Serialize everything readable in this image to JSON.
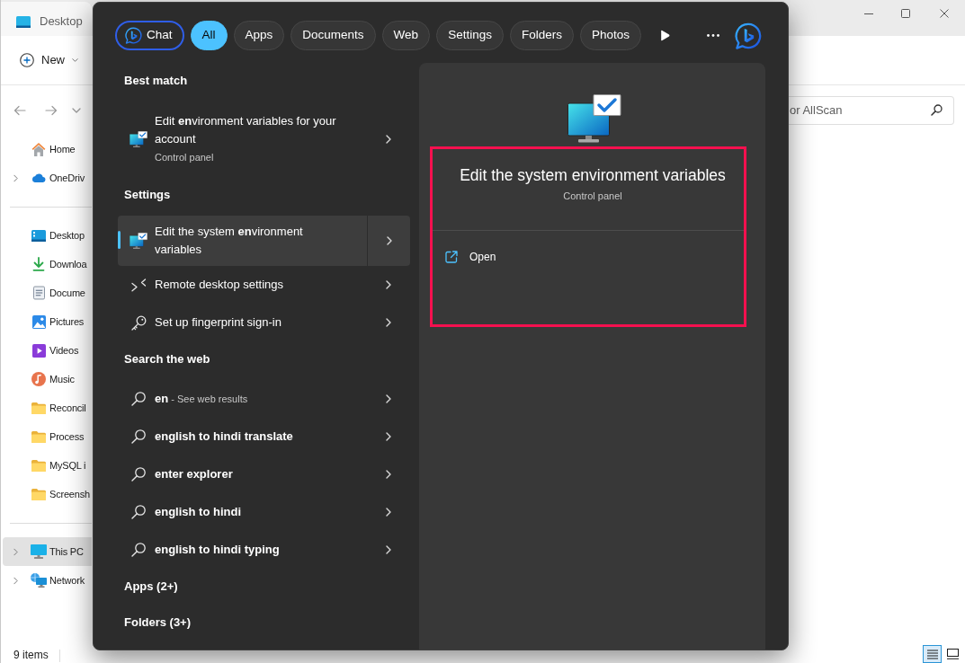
{
  "explorer": {
    "title": "Desktop",
    "new_button": "New",
    "search_placeholder": "or AllScan",
    "sidebar": {
      "groups": [
        {
          "items": [
            {
              "label": "Home",
              "kind": "home",
              "expandable": false,
              "selected": false
            },
            {
              "label": "OneDriv",
              "kind": "cloud",
              "expandable": true,
              "selected": false
            }
          ]
        },
        {
          "items": [
            {
              "label": "Desktop",
              "kind": "desktop",
              "expandable": false,
              "selected": false
            },
            {
              "label": "Downloa",
              "kind": "download",
              "expandable": false,
              "selected": false
            },
            {
              "label": "Docume",
              "kind": "document",
              "expandable": false,
              "selected": false
            },
            {
              "label": "Pictures",
              "kind": "pictures",
              "expandable": false,
              "selected": false
            },
            {
              "label": "Videos",
              "kind": "videos",
              "expandable": false,
              "selected": false
            },
            {
              "label": "Music",
              "kind": "music",
              "expandable": false,
              "selected": false
            },
            {
              "label": "Reconcil",
              "kind": "folder",
              "expandable": false,
              "selected": false
            },
            {
              "label": "Process",
              "kind": "folder",
              "expandable": false,
              "selected": false
            },
            {
              "label": "MySQL i",
              "kind": "folder",
              "expandable": false,
              "selected": false
            },
            {
              "label": "Screensh",
              "kind": "folder",
              "expandable": false,
              "selected": false
            }
          ]
        },
        {
          "items": [
            {
              "label": "This PC",
              "kind": "pc",
              "expandable": true,
              "selected": true
            },
            {
              "label": "Network",
              "kind": "network",
              "expandable": true,
              "selected": false
            }
          ]
        }
      ]
    },
    "status": "9 items",
    "views": [
      {
        "kind": "details",
        "selected": true
      },
      {
        "kind": "tiles",
        "selected": false
      }
    ]
  },
  "search": {
    "filters": [
      {
        "label": "Chat",
        "kind": "chat",
        "selected": false
      },
      {
        "label": "All",
        "kind": "filter",
        "selected": true
      },
      {
        "label": "Apps",
        "kind": "filter",
        "selected": false
      },
      {
        "label": "Documents",
        "kind": "filter",
        "selected": false
      },
      {
        "label": "Web",
        "kind": "filter",
        "selected": false
      },
      {
        "label": "Settings",
        "kind": "filter",
        "selected": false
      },
      {
        "label": "Folders",
        "kind": "filter",
        "selected": false
      },
      {
        "label": "Photos",
        "kind": "filter",
        "selected": false
      }
    ],
    "sections": [
      {
        "heading": "Best match",
        "items": [
          {
            "kind": "control-panel",
            "title": "Edit **en**vironment variables for your account",
            "subtitle": "Control panel",
            "selected": false
          }
        ]
      },
      {
        "heading": "Settings",
        "items": [
          {
            "kind": "control-panel",
            "title": "Edit the system **en**vironment variables",
            "selected": true
          },
          {
            "kind": "remote",
            "title": "Remote desktop settings",
            "selected": false
          },
          {
            "kind": "key",
            "title": "Set up fingerprint sign-in",
            "selected": false
          }
        ]
      },
      {
        "heading": "Search the web",
        "items": [
          {
            "kind": "web",
            "title": "en",
            "suffix": "- See web results",
            "selected": false
          },
          {
            "kind": "web",
            "title": "english to hindi translate",
            "selected": false
          },
          {
            "kind": "web",
            "title": "enter explorer",
            "selected": false
          },
          {
            "kind": "web",
            "title": "english to hindi",
            "selected": false
          },
          {
            "kind": "web",
            "title": "english to hindi typing",
            "selected": false
          }
        ]
      },
      {
        "heading": "Apps (2+)"
      },
      {
        "heading": "Folders (3+)"
      }
    ],
    "detail": {
      "title": "Edit the system environment variables",
      "subtitle": "Control panel",
      "highlighted": true,
      "actions": [
        {
          "label": "Open",
          "kind": "open"
        }
      ]
    }
  }
}
